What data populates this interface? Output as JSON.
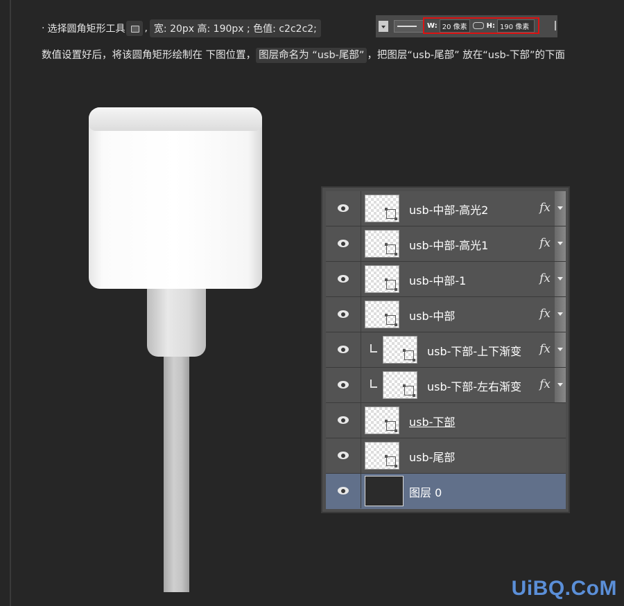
{
  "instruction1": {
    "bullet": "·",
    "prefix": "选择圆角矩形工具",
    "tool_icon": "rounded-rectangle-tool-icon",
    "comma": ",",
    "spec": "宽: 20px  高: 190px ; 色值: c2c2c2;"
  },
  "options_bar": {
    "w_label": "W:",
    "w_value": "20 像素",
    "h_label": "H:",
    "h_value": "190 像素",
    "link_icon": "link-icon",
    "highlight_color": "#dd1111"
  },
  "instruction2": {
    "part1": "数值设置好后，将该圆角矩形绘制在 下图位置，",
    "highlight": "图层命名为 “usb-尾部”",
    "part2": "，把图层“usb-尾部” 放在“usb-下部”的下面"
  },
  "layers": [
    {
      "name": "usb-中部-高光2",
      "fx": "fx",
      "clipped": false,
      "selected": false,
      "underlined": false
    },
    {
      "name": "usb-中部-高光1",
      "fx": "fx",
      "clipped": false,
      "selected": false,
      "underlined": false
    },
    {
      "name": "usb-中部-1",
      "fx": "fx",
      "clipped": false,
      "selected": false,
      "underlined": false
    },
    {
      "name": "usb-中部",
      "fx": "fx",
      "clipped": false,
      "selected": false,
      "underlined": false
    },
    {
      "name": "usb-下部-上下渐变",
      "fx": "fx",
      "clipped": true,
      "selected": false,
      "underlined": false
    },
    {
      "name": "usb-下部-左右渐变",
      "fx": "fx",
      "clipped": true,
      "selected": false,
      "underlined": false
    },
    {
      "name": "usb-下部",
      "fx": "",
      "clipped": false,
      "selected": false,
      "underlined": true
    },
    {
      "name": "usb-尾部",
      "fx": "",
      "clipped": false,
      "selected": false,
      "underlined": false
    },
    {
      "name": "图层 0",
      "fx": "",
      "clipped": false,
      "selected": true,
      "underlined": false
    }
  ],
  "watermark": "UiBQ.CoM"
}
